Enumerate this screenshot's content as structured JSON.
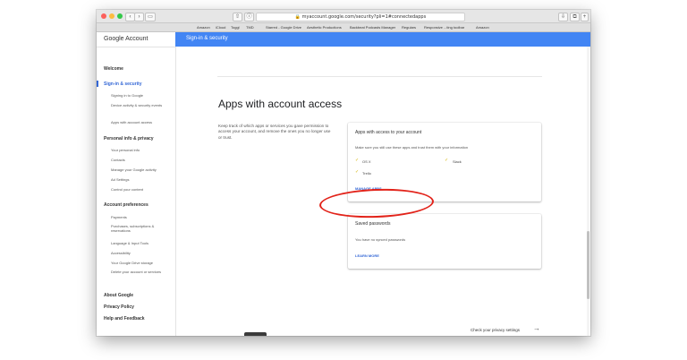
{
  "browser": {
    "url": "myaccount.google.com/security?pli=1#connectedapps",
    "bookmarks": [
      "Amazon",
      "iCloud",
      "Toggl",
      "TMD",
      "Starred - Google Drive",
      "Aesthetic Productions",
      "Backbeat Podcasts Manager",
      "Regulars",
      "Responsive ...ting toolbar",
      "Amazon"
    ]
  },
  "sidebar": {
    "logo": "Google Account",
    "welcome": "Welcome",
    "sign_in": {
      "label": "Sign-in & security",
      "items": [
        "Signing in to Google",
        "Device activity & security events",
        "Apps with account access"
      ]
    },
    "personal": {
      "label": "Personal info & privacy",
      "items": [
        "Your personal info",
        "Contacts",
        "Manage your Google activity",
        "Ad Settings",
        "Control your content"
      ]
    },
    "prefs": {
      "label": "Account preferences",
      "items": [
        "Payments",
        "Purchases, subscriptions & reservations",
        "Language & Input Tools",
        "Accessibility",
        "Your Google Drive storage",
        "Delete your account or services"
      ]
    },
    "about": "About Google",
    "privacy": "Privacy Policy",
    "help": "Help and Feedback"
  },
  "header": {
    "title": "Sign-in & security"
  },
  "main": {
    "title": "Apps with account access",
    "description": "Keep track of which apps or services you gave permission to access your account, and remove the ones you no longer use or trust.",
    "apps_card": {
      "title": "Apps with access to your account",
      "subtitle": "Make sure you still use these apps and trust them with your information",
      "apps": [
        "OS X",
        "Slack",
        "Trello"
      ],
      "link": "MANAGE APPS"
    },
    "passwords_card": {
      "title": "Saved passwords",
      "text": "You have no synced passwords",
      "link": "LEARN MORE"
    },
    "privacy_link": "Check your privacy settings"
  },
  "colors": {
    "accent": "#4285f4",
    "link": "#3367d6",
    "annotation": "#e2231a"
  }
}
